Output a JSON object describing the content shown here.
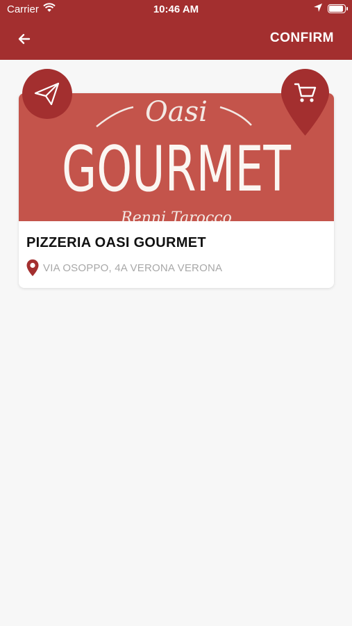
{
  "status_bar": {
    "carrier": "Carrier",
    "time": "10:46 AM"
  },
  "header": {
    "confirm_label": "CONFIRM",
    "background_color": "#a32f2f"
  },
  "restaurant": {
    "logo_script_top": "Oasi",
    "logo_main": "GOURMET",
    "logo_script_bottom": "Renni Tarocco",
    "name": "PIZZERIA OASI GOURMET",
    "address": "VIA OSOPPO, 4A VERONA VERONA",
    "banner_color": "#c4544b"
  },
  "icons": {
    "back": "back-arrow-icon",
    "share": "paper-plane-icon",
    "cart": "shopping-cart-icon",
    "address": "location-pin-icon"
  }
}
